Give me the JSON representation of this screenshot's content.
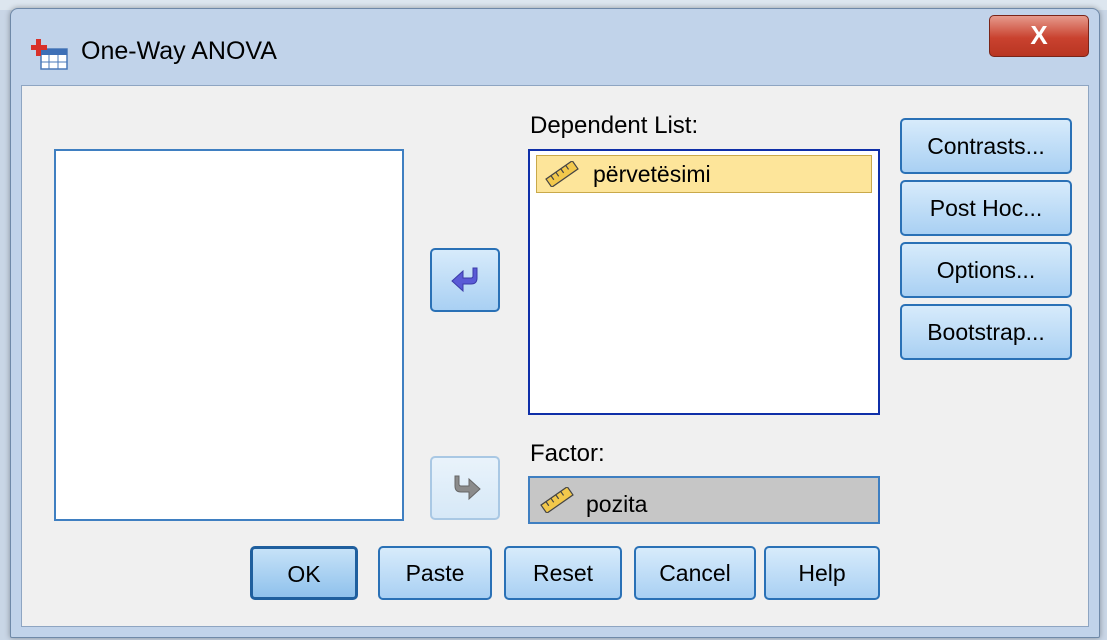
{
  "window": {
    "title": "One-Way ANOVA",
    "close_label": "X"
  },
  "dependent_list": {
    "label": "Dependent List:",
    "items": [
      {
        "name": "përvetësimi",
        "icon": "scale-ruler-icon"
      }
    ]
  },
  "factor": {
    "label": "Factor:",
    "value": "pozita",
    "icon": "scale-ruler-icon"
  },
  "side_buttons": {
    "contrasts": "Contrasts...",
    "post_hoc": "Post Hoc...",
    "options": "Options...",
    "bootstrap": "Bootstrap..."
  },
  "bottom_buttons": {
    "ok": "OK",
    "paste": "Paste",
    "reset": "Reset",
    "cancel": "Cancel",
    "help": "Help"
  },
  "colors": {
    "accent": "#2a71b6",
    "selected_item": "#fde59a",
    "close_button": "#c9422f",
    "window_frame": "#c1d3ea"
  }
}
